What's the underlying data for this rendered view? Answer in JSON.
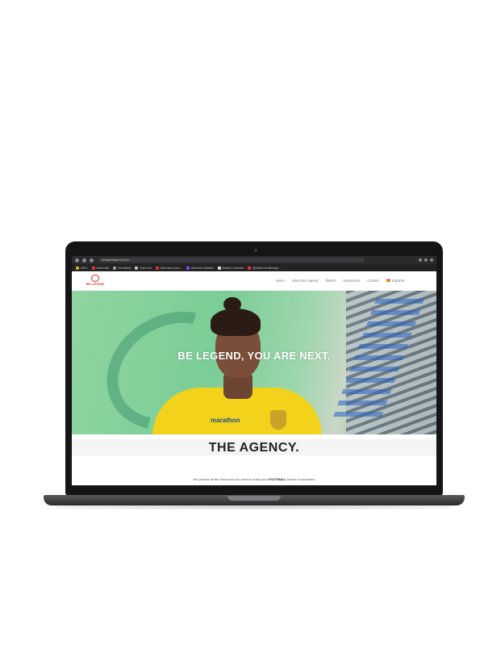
{
  "browser": {
    "url": "belegendagencia.com",
    "bookmarks": [
      {
        "label": "AEEV",
        "color": "#e0a81e"
      },
      {
        "label": "Nuevo sitio",
        "color": "#d33"
      },
      {
        "label": "Soundtrack",
        "color": "#999"
      },
      {
        "label": "Nuevo set",
        "color": "#bbb"
      },
      {
        "label": "Estructura y las p...",
        "color": "#d33"
      },
      {
        "label": "Ejercicios Gratuitos",
        "color": "#7c4dff"
      },
      {
        "label": "Edades y formatos",
        "color": "#ddd"
      },
      {
        "label": "Ejercicios de liderazgo...",
        "color": "#e33"
      }
    ]
  },
  "site": {
    "logo_text": "BE LEGEND",
    "nav": {
      "home": "Home",
      "about": "About Be Legend",
      "talents": "Talents",
      "experience": "Experience",
      "contact": "Contact",
      "language": "Español"
    },
    "hero": {
      "tagline": "BE LEGEND, YOU ARE NEXT.",
      "sponsor": "marathon"
    },
    "agency": {
      "title": "THE AGENCY.",
      "text_before": "We provide all the resources you need to make your ",
      "text_bold": "FOOTBALL",
      "text_after": " career a successful"
    }
  },
  "colors": {
    "brand_red": "#d6262e",
    "jersey_yellow": "#f2d21a",
    "hero_green": "#7bcd97"
  }
}
